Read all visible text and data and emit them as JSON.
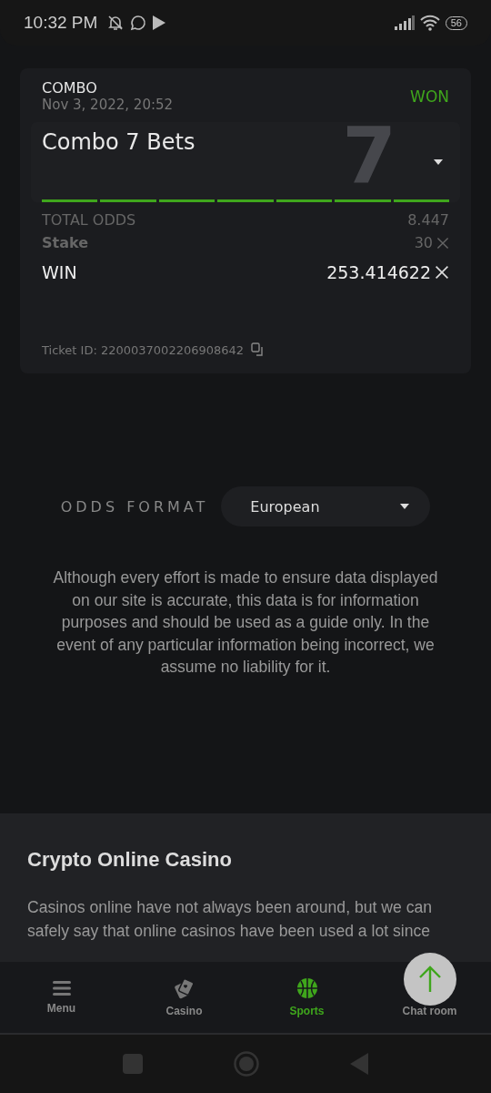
{
  "status_bar": {
    "time": "10:32 PM",
    "battery": "56"
  },
  "bet": {
    "type": "COMBO",
    "date": "Nov 3, 2022, 20:52",
    "result": "WON",
    "title": "Combo 7 Bets",
    "big_digit": "7",
    "expanded": false,
    "legs": [
      {
        "won": true
      },
      {
        "won": true
      },
      {
        "won": true
      },
      {
        "won": true
      },
      {
        "won": true
      },
      {
        "won": true
      },
      {
        "won": true
      }
    ],
    "total_odds_label": "TOTAL ODDS",
    "total_odds": "8.447",
    "stake_label": "Stake",
    "stake": "30",
    "win_label": "WIN",
    "win": "253.414622",
    "ticket_id": "Ticket ID: 2200037002206908642"
  },
  "odds_format": {
    "label": "ODDS FORMAT",
    "value": "European"
  },
  "disclaimer": "Although every effort is made to ensure data displayed on our site is accurate, this data is for information purposes and should be used as a guide only. In the event of any particular information being incorrect, we assume no liability for it.",
  "article": {
    "title": "Crypto Online Casino",
    "text": "Casinos online have not always been around, but we can safely say that online casinos have been used a lot since"
  },
  "bottom_nav": [
    {
      "kind": "menu",
      "label": "Menu",
      "selected": false
    },
    {
      "kind": "casino",
      "label": "Casino",
      "selected": false
    },
    {
      "kind": "sports",
      "label": "Sports",
      "selected": true
    },
    {
      "kind": "chat",
      "label": "Chat room",
      "selected": false
    }
  ]
}
